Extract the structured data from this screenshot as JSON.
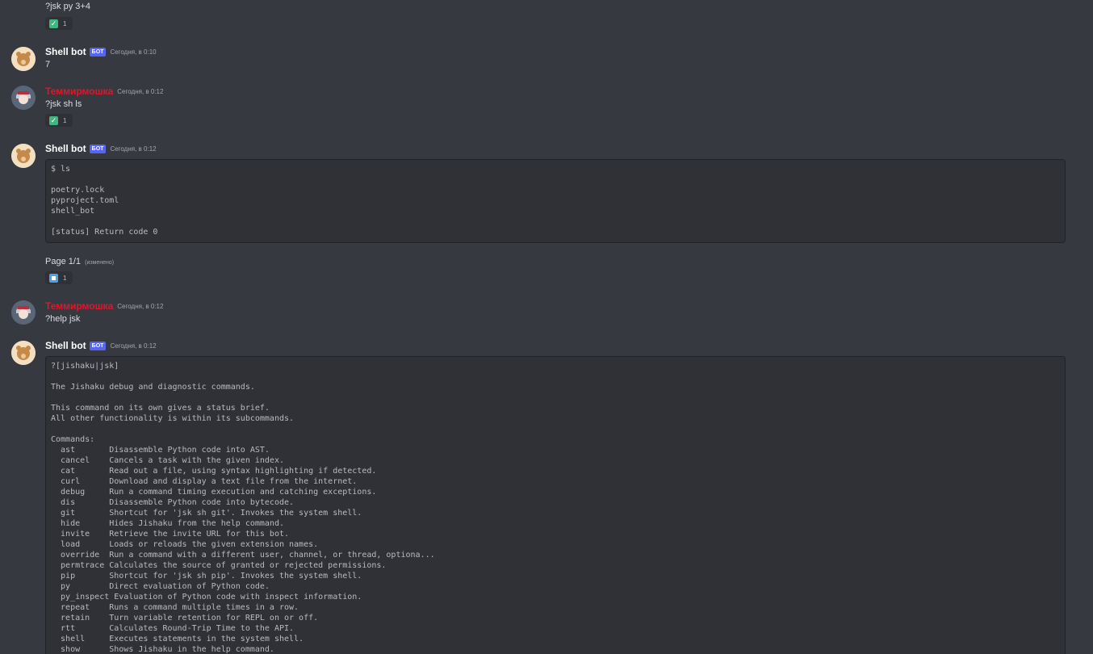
{
  "messages": {
    "m0": {
      "text": "?jsk py 3+4",
      "reaction_count": "1"
    },
    "m1": {
      "username": "Shell bot",
      "bot_tag": "БОТ",
      "timestamp": "Сегодня, в 0:10",
      "text": "7"
    },
    "m2": {
      "username": "Теммирмошка",
      "timestamp": "Сегодня, в 0:12",
      "text": "?jsk sh ls",
      "reaction_count": "1"
    },
    "m3": {
      "username": "Shell bot",
      "bot_tag": "БОТ",
      "timestamp": "Сегодня, в 0:12",
      "code": "$ ls\n\npoetry.lock\npyproject.toml\nshell_bot\n\n[status] Return code 0",
      "page_text": "Page 1/1",
      "edited": "(изменено)",
      "reaction_count": "1"
    },
    "m4": {
      "username": "Теммирмошка",
      "timestamp": "Сегодня, в 0:12",
      "text": "?help jsk"
    },
    "m5": {
      "username": "Shell bot",
      "bot_tag": "БОТ",
      "timestamp": "Сегодня, в 0:12",
      "code": "?[jishaku|jsk]\n\nThe Jishaku debug and diagnostic commands.\n\nThis command on its own gives a status brief.\nAll other functionality is within its subcommands.\n\nCommands:\n  ast       Disassemble Python code into AST.\n  cancel    Cancels a task with the given index.\n  cat       Read out a file, using syntax highlighting if detected.\n  curl      Download and display a text file from the internet.\n  debug     Run a command timing execution and catching exceptions.\n  dis       Disassemble Python code into bytecode.\n  git       Shortcut for 'jsk sh git'. Invokes the system shell.\n  hide      Hides Jishaku from the help command.\n  invite    Retrieve the invite URL for this bot.\n  load      Loads or reloads the given extension names.\n  override  Run a command with a different user, channel, or thread, optiona...\n  permtrace Calculates the source of granted or rejected permissions.\n  pip       Shortcut for 'jsk sh pip'. Invokes the system shell.\n  py        Direct evaluation of Python code.\n  py_inspect Evaluation of Python code with inspect information.\n  repeat    Runs a command multiple times in a row.\n  retain    Turn variable retention for REPL on or off.\n  rtt       Calculates Round-Trip Time to the API.\n  shell     Executes statements in the system shell.\n  show      Shows Jishaku in the help command."
    }
  },
  "colors": {
    "background": "#36393f",
    "bot_tag": "#5865f2",
    "red_username": "#e0162b",
    "codeblock_bg": "#2f3136"
  },
  "icons": {
    "check": "check-mark-button-icon",
    "square": "stop-button-icon"
  }
}
